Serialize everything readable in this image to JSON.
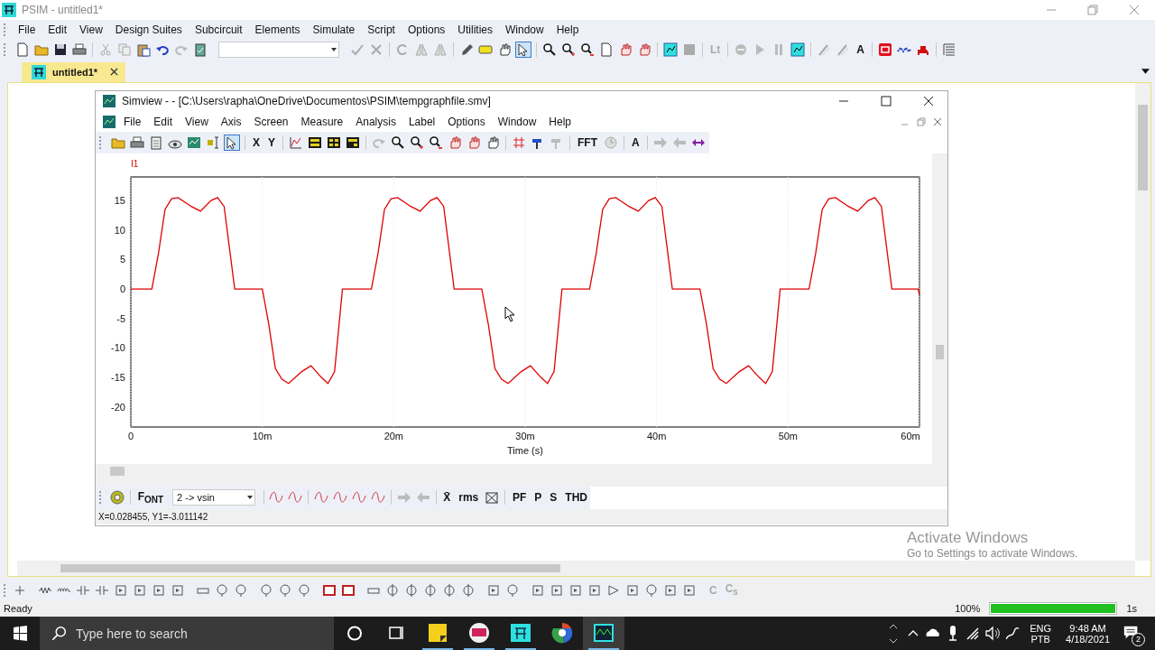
{
  "window": {
    "title": "PSIM - untitled1*"
  },
  "menu": [
    "File",
    "Edit",
    "View",
    "Design Suites",
    "Subcircuit",
    "Elements",
    "Simulate",
    "Script",
    "Options",
    "Utilities",
    "Window",
    "Help"
  ],
  "toolbar": {
    "pointer_tool_selected": true,
    "text_buttons": [
      {
        "label": "Lt",
        "disabled": true
      },
      {
        "label": "A",
        "disabled": false
      }
    ]
  },
  "tabs": [
    {
      "label": "untitled1*",
      "selected": true
    }
  ],
  "simview": {
    "title": "Simview -  - [C:\\Users\\rapha\\OneDrive\\Documentos\\PSIM\\tempgraphfile.smv]",
    "menu": [
      "File",
      "Edit",
      "View",
      "Axis",
      "Screen",
      "Measure",
      "Analysis",
      "Label",
      "Options",
      "Window",
      "Help"
    ],
    "toolbar": {
      "pointer_tool_selected": true,
      "text_buttons": [
        {
          "label": "X",
          "disabled": false
        },
        {
          "label": "Y",
          "disabled": false
        },
        {
          "label": "FFT",
          "disabled": false
        },
        {
          "label": "A",
          "disabled": false
        }
      ]
    },
    "chart_data": {
      "type": "line",
      "xlabel": "Time (s)",
      "grid": true,
      "xlim": [
        0,
        60
      ],
      "ylim": [
        -23.4,
        19
      ],
      "xticks": [
        {
          "value": 0,
          "label": "0"
        },
        {
          "value": 10,
          "label": "10m"
        },
        {
          "value": 20,
          "label": "20m"
        },
        {
          "value": 30,
          "label": "30m"
        },
        {
          "value": 40,
          "label": "40m"
        },
        {
          "value": 50,
          "label": "50m"
        },
        {
          "value": 60,
          "label": "60m"
        }
      ],
      "yticks": [
        15,
        10,
        5,
        0,
        -5,
        -10,
        -15,
        -20
      ],
      "x": [
        0,
        1.6,
        2.1,
        2.6,
        3.1,
        3.6,
        4.6,
        5.3,
        6.1,
        6.6,
        7.1,
        7.9,
        10.0,
        10.5,
        11.0,
        11.5,
        12.0,
        13.0,
        13.7,
        14.5,
        15.0,
        15.5,
        16.1,
        18.3,
        18.8,
        19.3,
        19.8,
        20.3,
        21.3,
        22.0,
        22.8,
        23.3,
        23.8,
        24.6,
        26.7,
        27.2,
        27.7,
        28.2,
        28.7,
        29.7,
        30.4,
        31.2,
        31.7,
        32.2,
        32.8,
        34.9,
        35.4,
        35.9,
        36.4,
        36.9,
        37.9,
        38.6,
        39.4,
        39.9,
        40.4,
        41.2,
        43.3,
        43.8,
        44.3,
        44.8,
        45.3,
        46.3,
        47.0,
        47.8,
        48.3,
        48.8,
        49.4,
        51.6,
        52.1,
        52.6,
        53.1,
        53.6,
        54.6,
        55.3,
        56.1,
        56.6,
        57.1,
        57.9,
        59.9,
        60.0
      ],
      "series": [
        {
          "name": "I1",
          "color": "#e00000",
          "values": [
            0,
            0,
            6,
            13.5,
            15.3,
            15.5,
            14,
            13.2,
            15,
            15.5,
            14,
            0,
            0,
            -6,
            -13.5,
            -15.3,
            -16,
            -14,
            -13,
            -15,
            -16,
            -14,
            0,
            0,
            6,
            13.5,
            15.3,
            15.5,
            14,
            13.2,
            15,
            15.5,
            14,
            0,
            0,
            -6,
            -13.5,
            -15.3,
            -16,
            -14,
            -13,
            -15,
            -16,
            -14,
            0,
            0,
            6,
            13.5,
            15.3,
            15.5,
            14,
            13.2,
            15,
            15.5,
            14,
            0,
            0,
            -6,
            -13.5,
            -15.3,
            -16,
            -14,
            -13,
            -15,
            -16,
            -14,
            0,
            0,
            6,
            13.5,
            15.3,
            15.5,
            14,
            13.2,
            15,
            15.5,
            14,
            0,
            0,
            -1
          ]
        }
      ]
    },
    "bottom_toolbar": {
      "signal": "2 -> vsin",
      "text_buttons": [
        {
          "label": "F$_{ONT}$",
          "disabled": false
        },
        {
          "label": "X̄",
          "disabled": false
        },
        {
          "label": "rms",
          "disabled": false
        },
        {
          "label": "PF",
          "disabled": false
        },
        {
          "label": "P",
          "disabled": false
        },
        {
          "label": "S",
          "disabled": false
        },
        {
          "label": "THD",
          "disabled": false
        }
      ]
    },
    "status": "X=0.028455, Y1=-3.011142"
  },
  "element_toolbar": {
    "text_buttons": [
      {
        "label": "C",
        "disabled": true
      },
      {
        "label": "C$_{s}$",
        "disabled": true
      }
    ]
  },
  "watermark": {
    "title": "Activate Windows",
    "subtitle": "Go to Settings to activate Windows."
  },
  "status_bar": {
    "text": "Ready",
    "zoom": "100%",
    "progress": {
      "level": 1.0
    },
    "time": "1s"
  },
  "taskbar": {
    "search": {
      "placeholder": "Type here to search"
    },
    "language": "ENG",
    "layout": "PTB",
    "time": "9:48 AM",
    "date": "4/18/2021",
    "notifications": "2"
  }
}
